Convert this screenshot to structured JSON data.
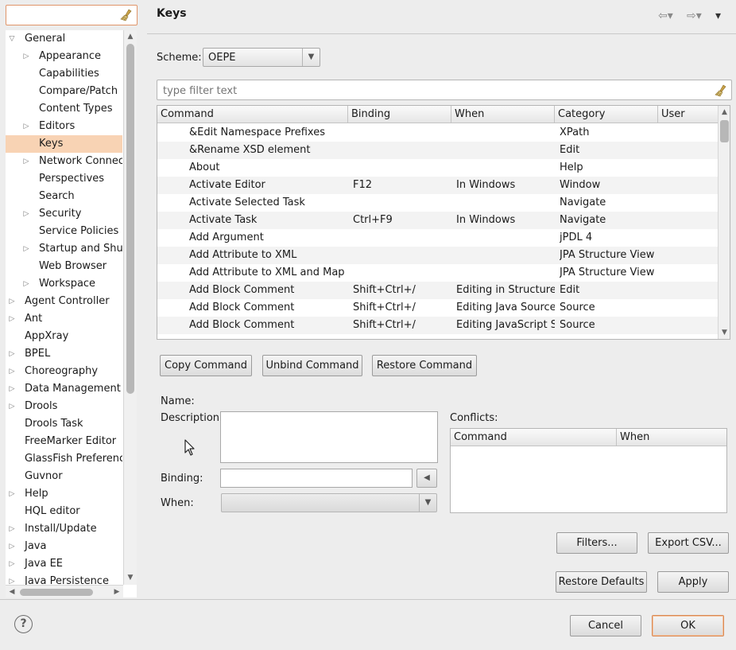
{
  "tree": {
    "filter_value": "",
    "items": [
      {
        "label": "General",
        "level": 0,
        "twisty": "expanded"
      },
      {
        "label": "Appearance",
        "level": 1,
        "twisty": "collapsed"
      },
      {
        "label": "Capabilities",
        "level": 1,
        "twisty": "none"
      },
      {
        "label": "Compare/Patch",
        "level": 1,
        "twisty": "none"
      },
      {
        "label": "Content Types",
        "level": 1,
        "twisty": "none"
      },
      {
        "label": "Editors",
        "level": 1,
        "twisty": "collapsed"
      },
      {
        "label": "Keys",
        "level": 1,
        "twisty": "none",
        "selected": true
      },
      {
        "label": "Network Connections",
        "level": 1,
        "twisty": "collapsed"
      },
      {
        "label": "Perspectives",
        "level": 1,
        "twisty": "none"
      },
      {
        "label": "Search",
        "level": 1,
        "twisty": "none"
      },
      {
        "label": "Security",
        "level": 1,
        "twisty": "collapsed"
      },
      {
        "label": "Service Policies",
        "level": 1,
        "twisty": "none"
      },
      {
        "label": "Startup and Shutdown",
        "level": 1,
        "twisty": "collapsed"
      },
      {
        "label": "Web Browser",
        "level": 1,
        "twisty": "none"
      },
      {
        "label": "Workspace",
        "level": 1,
        "twisty": "collapsed"
      },
      {
        "label": "Agent Controller",
        "level": 0,
        "twisty": "collapsed"
      },
      {
        "label": "Ant",
        "level": 0,
        "twisty": "collapsed"
      },
      {
        "label": "AppXray",
        "level": 0,
        "twisty": "none"
      },
      {
        "label": "BPEL",
        "level": 0,
        "twisty": "collapsed"
      },
      {
        "label": "Choreography",
        "level": 0,
        "twisty": "collapsed"
      },
      {
        "label": "Data Management",
        "level": 0,
        "twisty": "collapsed"
      },
      {
        "label": "Drools",
        "level": 0,
        "twisty": "collapsed"
      },
      {
        "label": "Drools Task",
        "level": 0,
        "twisty": "none"
      },
      {
        "label": "FreeMarker Editor",
        "level": 0,
        "twisty": "none"
      },
      {
        "label": "GlassFish Preferences",
        "level": 0,
        "twisty": "none"
      },
      {
        "label": "Guvnor",
        "level": 0,
        "twisty": "none"
      },
      {
        "label": "Help",
        "level": 0,
        "twisty": "collapsed"
      },
      {
        "label": "HQL editor",
        "level": 0,
        "twisty": "none"
      },
      {
        "label": "Install/Update",
        "level": 0,
        "twisty": "collapsed"
      },
      {
        "label": "Java",
        "level": 0,
        "twisty": "collapsed"
      },
      {
        "label": "Java EE",
        "level": 0,
        "twisty": "collapsed"
      },
      {
        "label": "Java Persistence",
        "level": 0,
        "twisty": "collapsed"
      }
    ]
  },
  "page": {
    "title": "Keys",
    "scheme_label": "Scheme:",
    "scheme_value": "OEPE",
    "filter_placeholder": "type filter text"
  },
  "keys_table": {
    "columns": [
      "Command",
      "Binding",
      "When",
      "Category",
      "User"
    ],
    "rows": [
      [
        "&Edit Namespace Prefixes",
        "",
        "",
        "XPath",
        ""
      ],
      [
        "&Rename XSD element",
        "",
        "",
        "Edit",
        ""
      ],
      [
        "About",
        "",
        "",
        "Help",
        ""
      ],
      [
        "Activate Editor",
        "F12",
        "In Windows",
        "Window",
        ""
      ],
      [
        "Activate Selected Task",
        "",
        "",
        "Navigate",
        ""
      ],
      [
        "Activate Task",
        "Ctrl+F9",
        "In Windows",
        "Navigate",
        ""
      ],
      [
        "Add Argument",
        "",
        "",
        "jPDL 4",
        ""
      ],
      [
        "Add Attribute to XML",
        "",
        "",
        "JPA Structure View",
        ""
      ],
      [
        "Add Attribute to XML and Map ...",
        "",
        "",
        "JPA Structure View",
        ""
      ],
      [
        "Add Block Comment",
        "Shift+Ctrl+/",
        "Editing in Structured Text Editors",
        "Edit",
        ""
      ],
      [
        "Add Block Comment",
        "Shift+Ctrl+/",
        "Editing Java Source",
        "Source",
        ""
      ],
      [
        "Add Block Comment",
        "Shift+Ctrl+/",
        "Editing JavaScript Source",
        "Source",
        ""
      ]
    ]
  },
  "buttons": {
    "copy_command": "Copy Command",
    "unbind_command": "Unbind Command",
    "restore_command": "Restore Command",
    "filters": "Filters...",
    "export_csv": "Export CSV...",
    "restore_defaults": "Restore Defaults",
    "apply": "Apply",
    "cancel": "Cancel",
    "ok": "OK"
  },
  "details": {
    "name_label": "Name:",
    "description_label": "Description:",
    "binding_label": "Binding:",
    "when_label": "When:",
    "conflicts_label": "Conflicts:",
    "conflicts_columns": [
      "Command",
      "When"
    ]
  },
  "icons": {
    "help": "?"
  },
  "colors": {
    "selection": "#f8d3b4",
    "focus_border": "#e0956a"
  }
}
